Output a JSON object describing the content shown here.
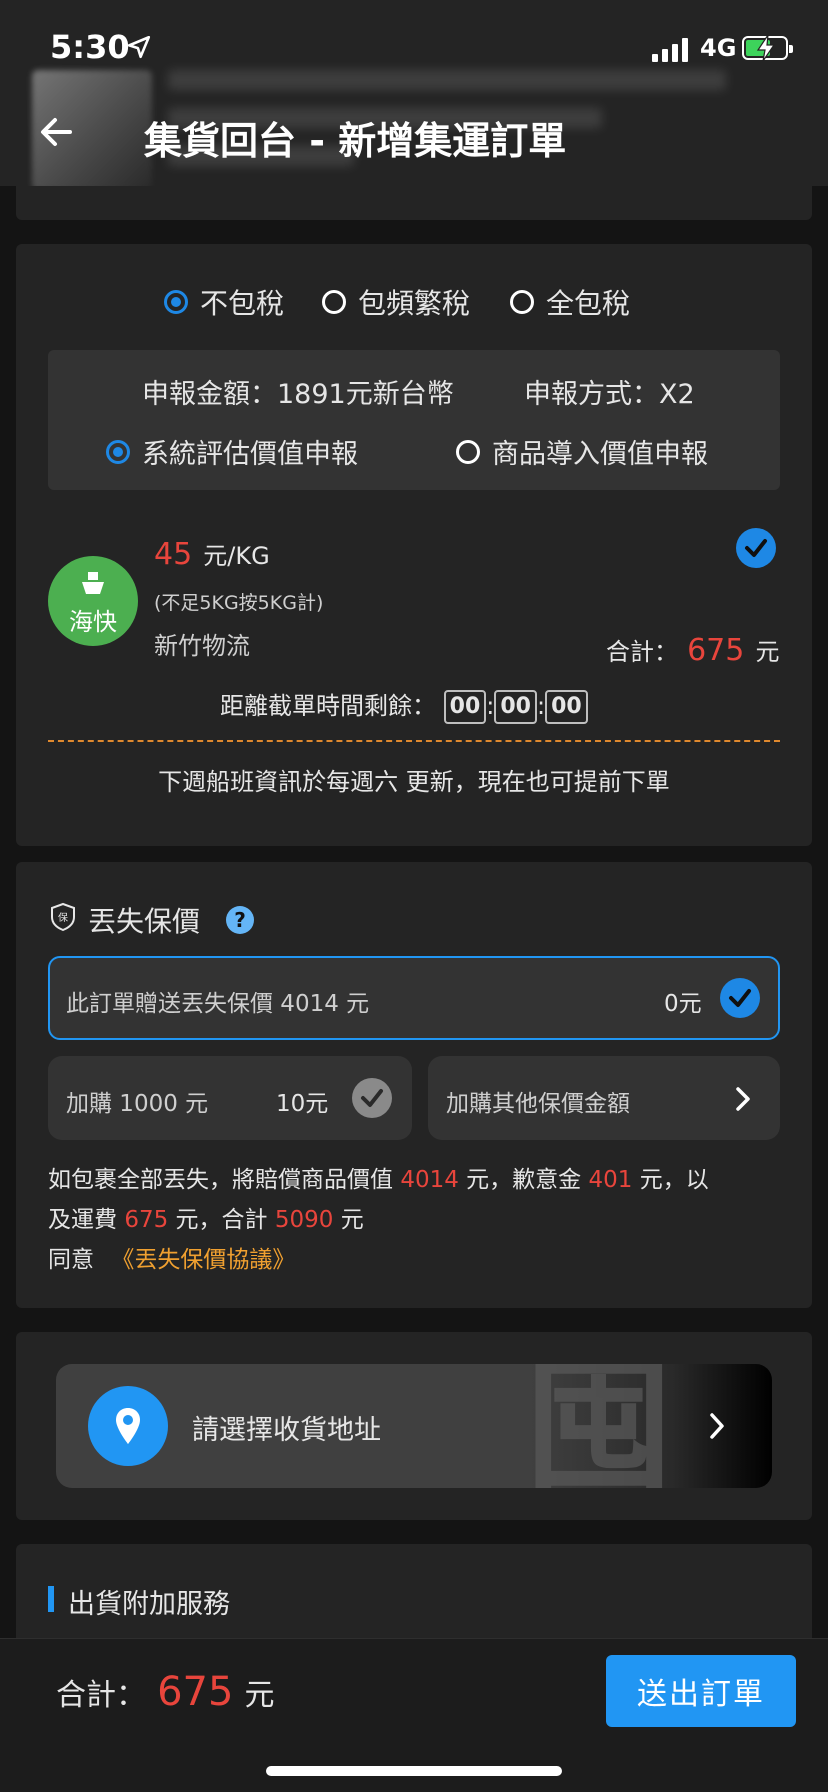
{
  "status_bar": {
    "time": "5:30",
    "network": "4G"
  },
  "header": {
    "title": "集貨回台 - 新增集運訂單"
  },
  "tax": {
    "options": [
      "不包稅",
      "包頻繁稅",
      "全包稅"
    ],
    "selected": "不包稅",
    "declared_amount": "申報金額：1891元新台幣",
    "declare_method": "申報方式：X2",
    "value_options": [
      "系統評估價值申報",
      "商品導入價值申報"
    ],
    "value_selected": "系統評估價值申報"
  },
  "shipping": {
    "badge": "海快",
    "price": "45",
    "unit": "元/KG",
    "min_note": "(不足5KG按5KG計)",
    "carrier": "新竹物流",
    "total_label": "合計：",
    "total_value": "675",
    "total_unit": "元",
    "countdown_label": "距離截單時間剩餘：",
    "countdown": [
      "00",
      "00",
      "00"
    ],
    "schedule_note": "下週船班資訊於每週六 更新，現在也可提前下單"
  },
  "insurance": {
    "title": "丟失保價",
    "gift_label": "此訂單贈送丟失保價 4014 元",
    "gift_price": "0元",
    "addon_label": "加購 1000 元",
    "addon_price": "10元",
    "other_label": "加購其他保價金額",
    "desc_1": "如包裹全部丟失，將賠償商品價值",
    "value": "4014",
    "desc_2": "元，歉意金",
    "apology": "401",
    "desc_3": "元，以",
    "desc_4": "及運費",
    "freight": "675",
    "desc_5": "元，合計",
    "sum": "5090",
    "desc_6": "元",
    "agree": "同意",
    "agreement_link": "《丟失保價協議》"
  },
  "address": {
    "placeholder": "請選擇收貨地址",
    "watermark": "囤"
  },
  "extras": {
    "title": "出貨附加服務"
  },
  "footer": {
    "total_label": "合計：",
    "total_value": "675",
    "total_unit": "元",
    "submit": "送出訂單"
  },
  "colors": {
    "accent": "#2196f3",
    "price_red": "#e8453c",
    "link_orange": "#f0a030",
    "sea_green": "#4caf50"
  }
}
